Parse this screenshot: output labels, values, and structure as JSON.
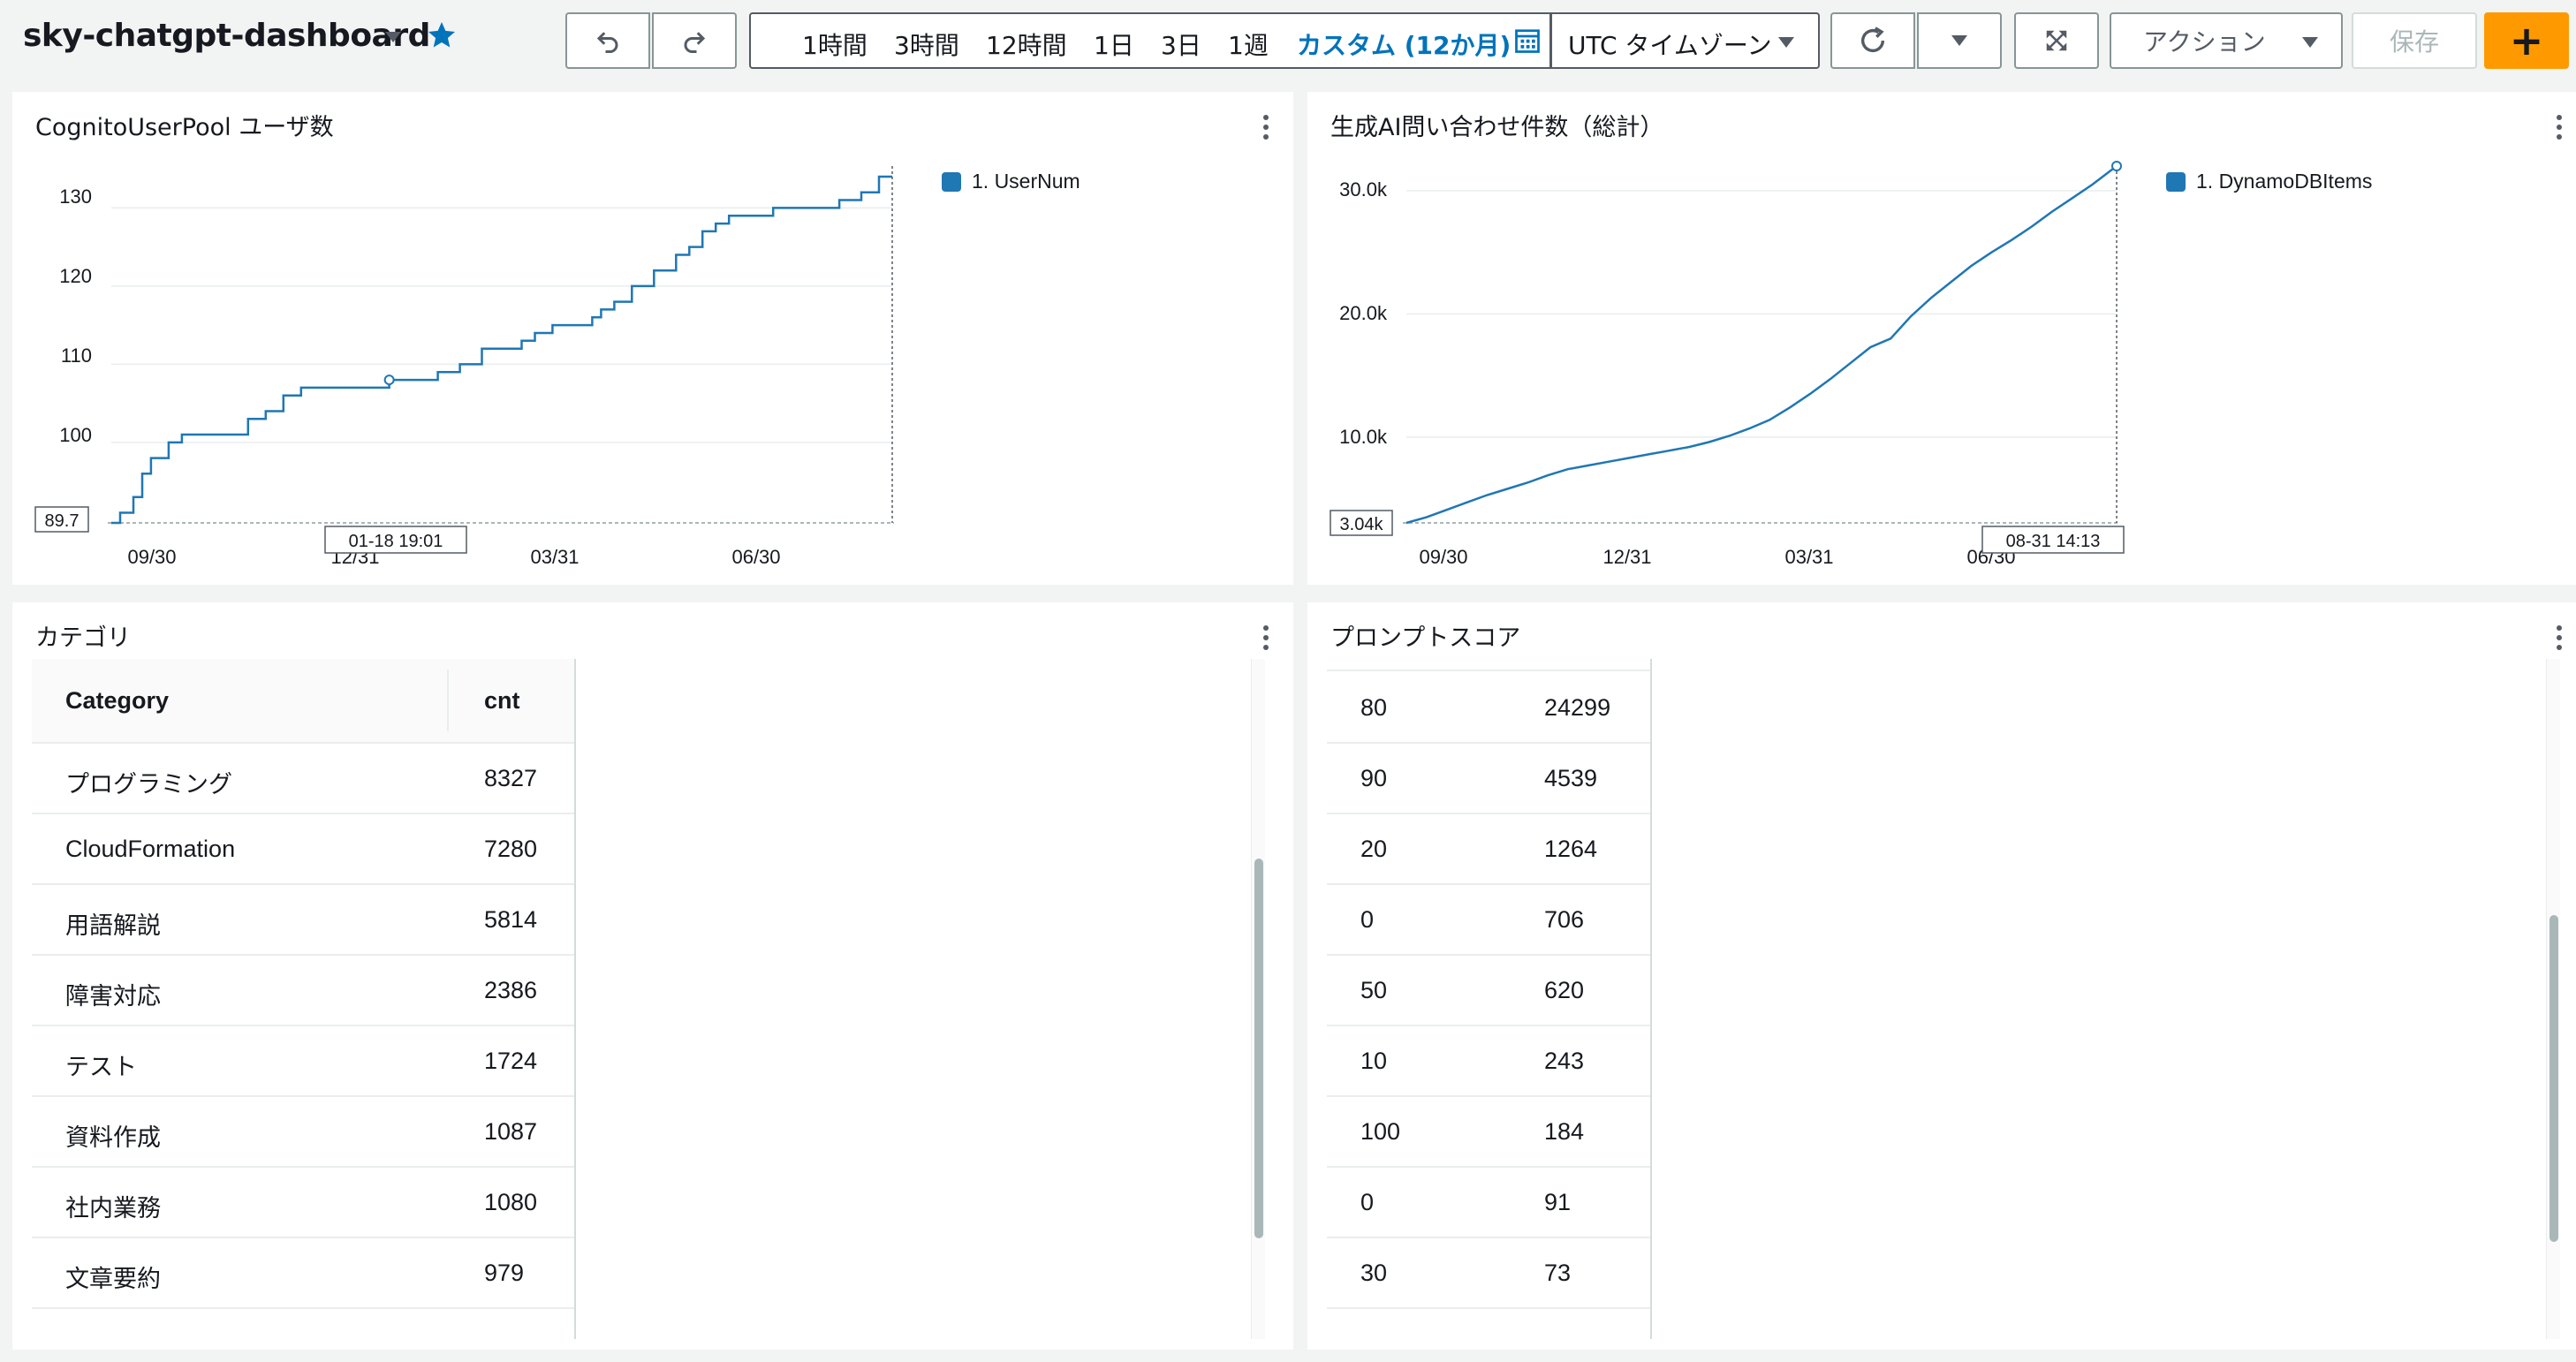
{
  "dashboard": {
    "title": "sky-chatgpt-dashboard"
  },
  "toolbar": {
    "ranges": [
      "1時間",
      "3時間",
      "12時間",
      "1日",
      "3日",
      "1週"
    ],
    "active_range": "カスタム (12か月)",
    "timezone": "UTC タイムゾーン",
    "actions_label": "アクション",
    "save_label": "保存",
    "add_label": "+"
  },
  "widgets": {
    "users": {
      "title": "CognitoUserPool ユーザ数",
      "legend": "1. UserNum",
      "min_label": "89.7",
      "cursor_label": "01-18 19:01",
      "y_ticks": [
        "100",
        "110",
        "120",
        "130"
      ],
      "x_ticks": [
        "09/30",
        "12/31",
        "03/31",
        "06/30"
      ]
    },
    "genai": {
      "title": "生成AI問い合わせ件数（総計）",
      "legend": "1. DynamoDBItems",
      "min_label": "3.04k",
      "cursor_label": "08-31 14:13",
      "y_ticks": [
        "10.0k",
        "20.0k",
        "30.0k"
      ],
      "x_ticks": [
        "09/30",
        "12/31",
        "03/31",
        "06/30"
      ]
    },
    "category": {
      "title": "カテゴリ",
      "headers": [
        "Category",
        "cnt"
      ],
      "rows": [
        [
          "プログラミング",
          "8327"
        ],
        [
          "CloudFormation",
          "7280"
        ],
        [
          "用語解説",
          "5814"
        ],
        [
          "障害対応",
          "2386"
        ],
        [
          "テスト",
          "1724"
        ],
        [
          "資料作成",
          "1087"
        ],
        [
          "社内業務",
          "1080"
        ],
        [
          "文章要約",
          "979"
        ]
      ]
    },
    "score": {
      "title": "プロンプトスコア",
      "rows": [
        [
          "80",
          "24299"
        ],
        [
          "90",
          "4539"
        ],
        [
          "20",
          "1264"
        ],
        [
          "0",
          "706"
        ],
        [
          "50",
          "620"
        ],
        [
          "10",
          "243"
        ],
        [
          "100",
          "184"
        ],
        [
          "0",
          "91"
        ],
        [
          "30",
          "73"
        ]
      ]
    }
  },
  "chart_data": [
    {
      "type": "line",
      "ylim": [
        89.7,
        134
      ],
      "y_ticks": [
        100,
        110,
        120,
        130
      ],
      "x_ticks": [
        "09/30",
        "12/31",
        "03/31",
        "06/30"
      ],
      "series": [
        {
          "name": "1. UserNum",
          "x_days": [
            0,
            4,
            10,
            14,
            18,
            22,
            26,
            32,
            40,
            50,
            62,
            70,
            78,
            86,
            94,
            102,
            112,
            126,
            138,
            148,
            158,
            168,
            178,
            186,
            192,
            200,
            206,
            210,
            214,
            218,
            222,
            228,
            236,
            246,
            256,
            262,
            268,
            274,
            280,
            290,
            300,
            320,
            330,
            340,
            348,
            354
          ],
          "values": [
            89.7,
            91,
            93,
            96,
            98,
            98,
            100,
            101,
            101,
            101,
            103,
            104,
            106,
            107,
            107,
            107,
            107,
            108,
            108,
            109,
            110,
            112,
            112,
            113,
            114,
            115,
            115,
            115,
            115,
            116,
            117,
            118,
            120,
            122,
            124,
            125,
            127,
            128,
            129,
            129,
            130,
            130,
            131,
            132,
            134,
            134
          ]
        }
      ]
    },
    {
      "type": "line",
      "ylim": [
        3040,
        32000
      ],
      "y_ticks": [
        10000,
        20000,
        30000
      ],
      "x_ticks": [
        "09/30",
        "12/31",
        "03/31",
        "06/30"
      ],
      "series": [
        {
          "name": "1. DynamoDBItems",
          "x_days": [
            0,
            10,
            20,
            30,
            40,
            50,
            60,
            70,
            80,
            90,
            100,
            110,
            120,
            130,
            140,
            150,
            160,
            170,
            180,
            190,
            200,
            210,
            220,
            230,
            240,
            250,
            260,
            270,
            280,
            290,
            300,
            310,
            320,
            330,
            340,
            352
          ],
          "values": [
            3040,
            3500,
            4100,
            4700,
            5300,
            5800,
            6300,
            6900,
            7400,
            7700,
            8000,
            8300,
            8600,
            8900,
            9200,
            9600,
            10100,
            10700,
            11400,
            12400,
            13500,
            14700,
            16000,
            17300,
            18000,
            19800,
            21300,
            22600,
            23900,
            25000,
            26000,
            27100,
            28300,
            29400,
            30500,
            32000
          ]
        }
      ]
    }
  ]
}
